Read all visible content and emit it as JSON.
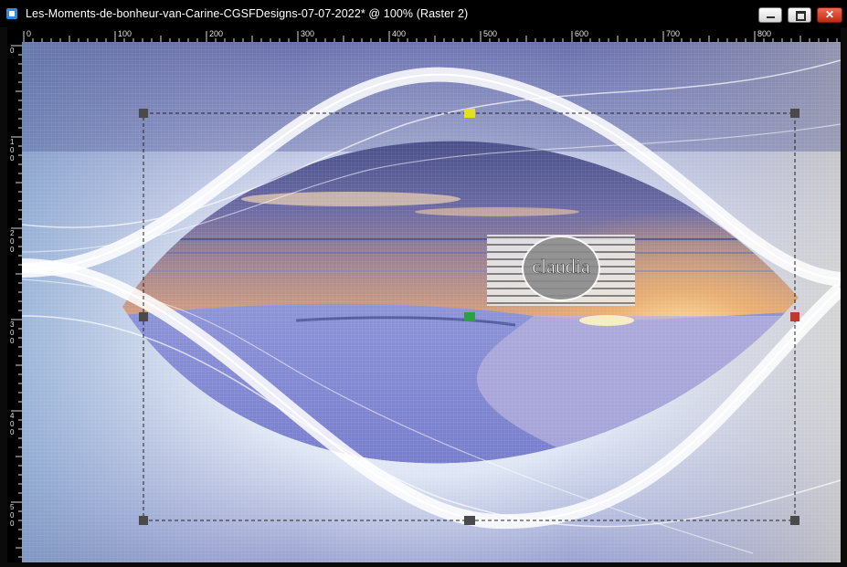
{
  "window": {
    "title": "Les-Moments-de-bonheur-van-Carine-CGSFDesigns-07-07-2022* @ 100% (Raster 2)"
  },
  "ruler": {
    "horizontal_labels": [
      "0",
      "100",
      "200",
      "300",
      "400",
      "500",
      "600",
      "700",
      "800"
    ],
    "vertical_labels": [
      "0",
      "100",
      "200",
      "300",
      "400",
      "500"
    ]
  },
  "canvas": {
    "watermark_text": "claudia",
    "colors": {
      "frame_blue": "#4a55a0",
      "sunset_orange": "#f5b062",
      "sea_blue": "#3b4f98",
      "curve_white": "#ffffff"
    }
  },
  "icons": {
    "app": "paint-app-icon",
    "minimize": "minimize-icon",
    "maximize": "maximize-icon",
    "close": "close-icon"
  }
}
